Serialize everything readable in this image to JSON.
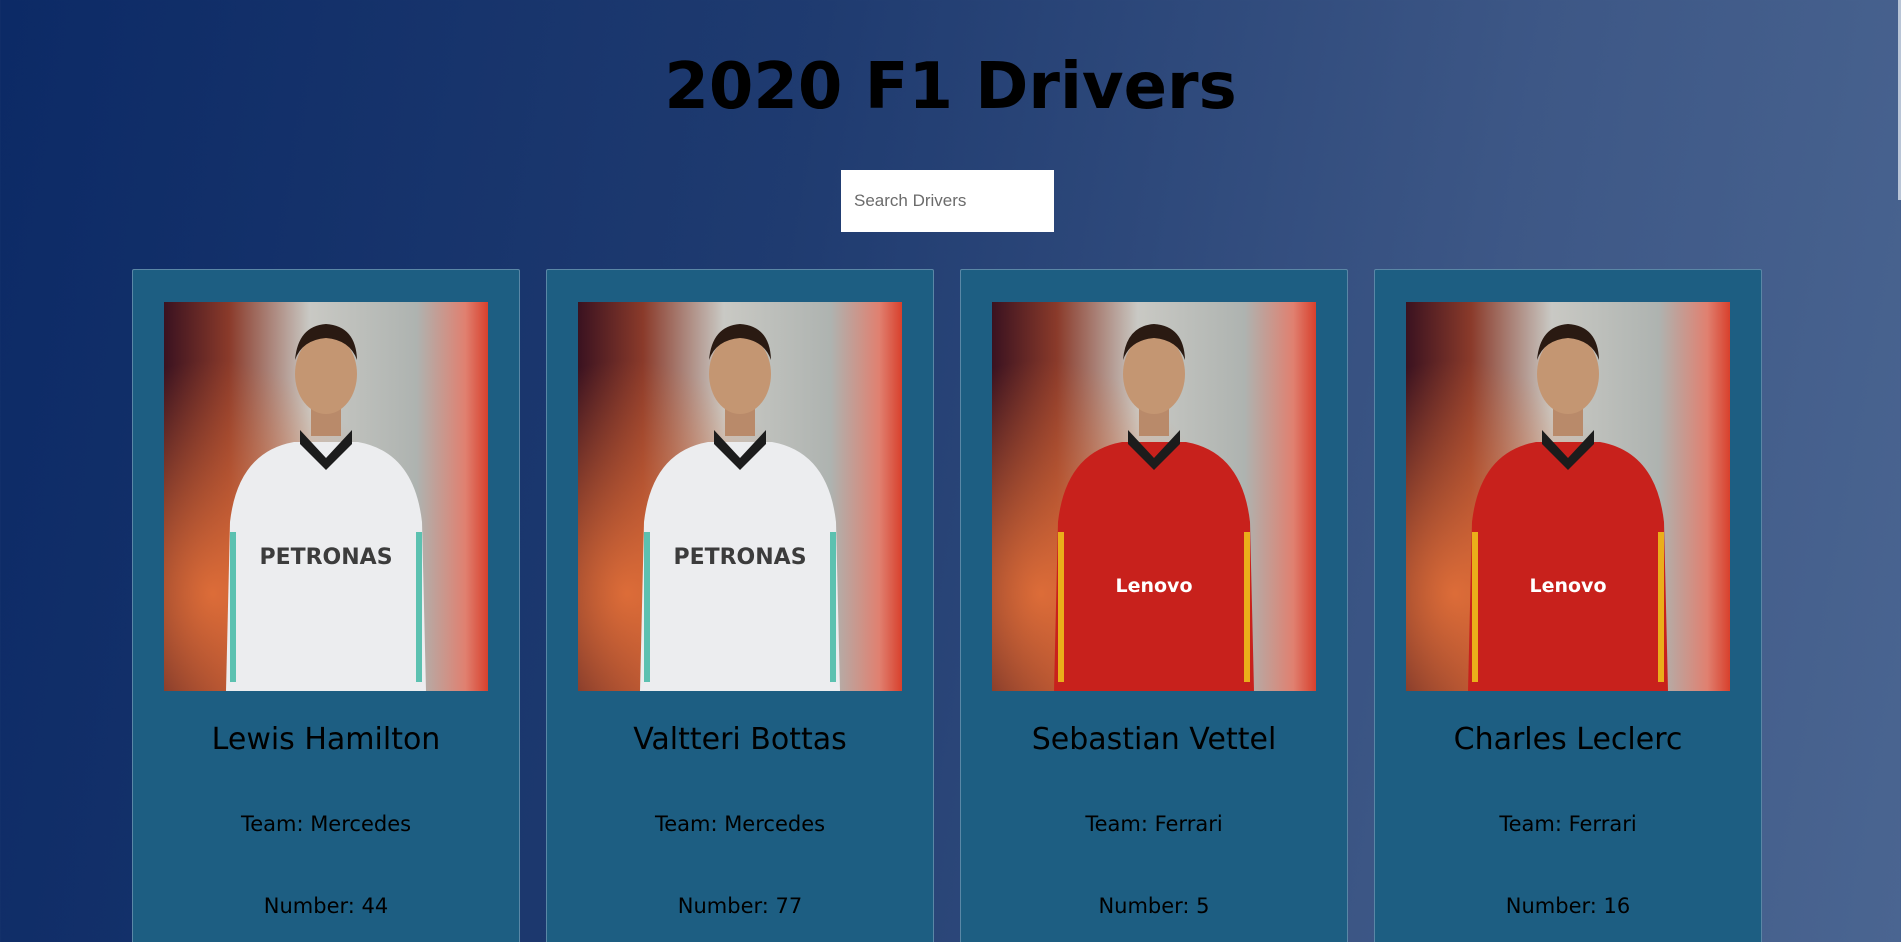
{
  "page": {
    "title": "2020 F1 Drivers"
  },
  "search": {
    "placeholder": "Search Drivers",
    "value": ""
  },
  "drivers": [
    {
      "name": "Lewis Hamilton",
      "team": "Team: Mercedes",
      "number": "Number: 44",
      "suit": "white",
      "suit_color": "#ecedef",
      "trim_color": "#38b5a0",
      "chest_text": "PETRONAS"
    },
    {
      "name": "Valtteri Bottas",
      "team": "Team: Mercedes",
      "number": "Number: 77",
      "suit": "white",
      "suit_color": "#ecedef",
      "trim_color": "#38b5a0",
      "chest_text": "PETRONAS"
    },
    {
      "name": "Sebastian Vettel",
      "team": "Team: Ferrari",
      "number": "Number: 5",
      "suit": "red",
      "suit_color": "#c8211c",
      "trim_color": "#f2d21a",
      "chest_text": "Lenovo"
    },
    {
      "name": "Charles Leclerc",
      "team": "Team: Ferrari",
      "number": "Number: 16",
      "suit": "red",
      "suit_color": "#c8211c",
      "trim_color": "#f2d21a",
      "chest_text": "Lenovo"
    }
  ],
  "colors": {
    "card_background": "#1d5e82",
    "page_gradient_start": "#0c2a66",
    "page_gradient_end": "#4a6591"
  }
}
